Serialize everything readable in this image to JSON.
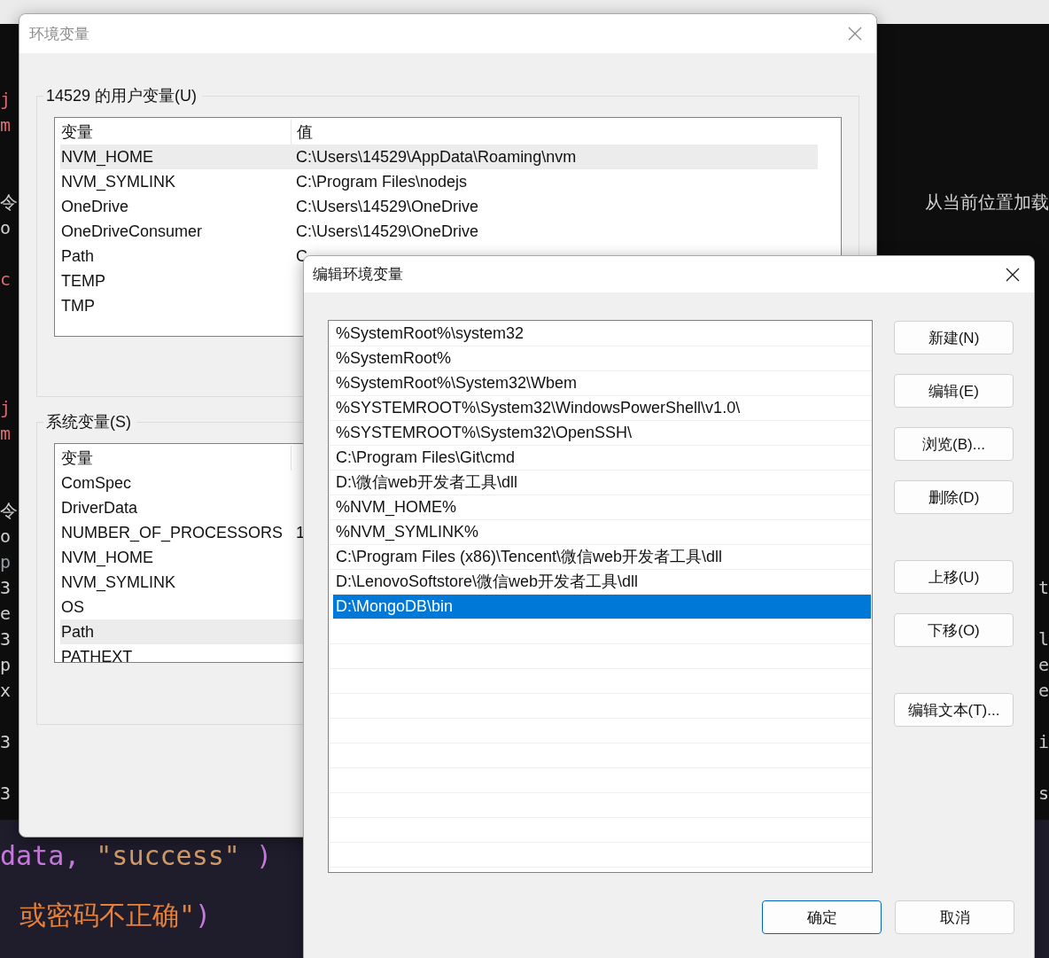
{
  "editor": {
    "lines": [
      {
        "kind": "code",
        "left": {
          "text": "j",
          "color": "#e06c75"
        }
      },
      {
        "kind": "code",
        "left": {
          "text": "m",
          "color": "#e06c75"
        }
      },
      {
        "kind": "blank"
      },
      {
        "kind": "blank"
      },
      {
        "kind": "code",
        "left": {
          "text": "令",
          "color": "#d4d4d4"
        },
        "right": {
          "text": "从当前位置加载",
          "color": "#d4d4d4"
        }
      },
      {
        "kind": "code",
        "left": {
          "text": "o",
          "color": "#d4d4d4"
        }
      },
      {
        "kind": "blank"
      },
      {
        "kind": "code",
        "left": {
          "text": "c",
          "color": "#e06c75"
        }
      },
      {
        "kind": "blank"
      },
      {
        "kind": "blank"
      },
      {
        "kind": "blank"
      },
      {
        "kind": "blank"
      },
      {
        "kind": "code",
        "left": {
          "text": "j",
          "color": "#e06c75"
        }
      },
      {
        "kind": "code",
        "left": {
          "text": "m",
          "color": "#e06c75"
        }
      },
      {
        "kind": "blank"
      },
      {
        "kind": "blank"
      },
      {
        "kind": "code",
        "left": {
          "text": "令",
          "color": "#d4d4d4"
        }
      },
      {
        "kind": "code",
        "left": {
          "text": "o",
          "color": "#d4d4d4"
        }
      },
      {
        "kind": "code",
        "left": {
          "text": "p",
          "color": "#9a9fa8"
        }
      },
      {
        "kind": "code",
        "left": {
          "text": "3",
          "color": "#d4d4d4"
        },
        "right": {
          "text": "t",
          "color": "#d4d4d4"
        }
      },
      {
        "kind": "code",
        "left": {
          "text": "e",
          "color": "#d4d4d4"
        }
      },
      {
        "kind": "code",
        "left": {
          "text": "3",
          "color": "#d4d4d4"
        },
        "right": {
          "text": "l",
          "color": "#d4d4d4"
        }
      },
      {
        "kind": "code",
        "left": {
          "text": "p",
          "color": "#d4d4d4"
        },
        "right": {
          "text": "e",
          "color": "#d4d4d4"
        }
      },
      {
        "kind": "code",
        "left": {
          "text": "x",
          "color": "#d4d4d4"
        },
        "right": {
          "text": "e",
          "color": "#d4d4d4"
        }
      },
      {
        "kind": "blank"
      },
      {
        "kind": "code",
        "left": {
          "text": "3",
          "color": "#d4d4d4"
        },
        "right": {
          "text": "i",
          "color": "#d4d4d4"
        }
      },
      {
        "kind": "blank"
      },
      {
        "kind": "code",
        "left": {
          "text": "3",
          "color": "#d4d4d4"
        },
        "right": {
          "text": "s",
          "color": "#d4d4d4"
        }
      }
    ],
    "bottom_lines": [
      [
        {
          "text": "data,",
          "color": "#c678dd"
        },
        {
          "text": "\"success\"",
          "color": "#d19a66"
        },
        {
          "text": ")",
          "color": "#c678dd"
        }
      ],
      [
        {
          "text": "或密码不正确\"",
          "color": "#e5813b"
        },
        {
          "text": ")",
          "color": "#c678dd"
        }
      ]
    ]
  },
  "env_window": {
    "title": "环境变量",
    "user_group": {
      "title": "14529 的用户变量(U)",
      "columns": [
        "变量",
        "值"
      ],
      "rows": [
        {
          "name": "NVM_HOME",
          "value": "C:\\Users\\14529\\AppData\\Roaming\\nvm",
          "selected": true
        },
        {
          "name": "NVM_SYMLINK",
          "value": "C:\\Program Files\\nodejs",
          "selected": false
        },
        {
          "name": "OneDrive",
          "value": "C:\\Users\\14529\\OneDrive",
          "selected": false
        },
        {
          "name": "OneDriveConsumer",
          "value": "C:\\Users\\14529\\OneDrive",
          "selected": false
        },
        {
          "name": "Path",
          "value": "C",
          "selected": false
        },
        {
          "name": "TEMP",
          "selected": false
        },
        {
          "name": "TMP",
          "selected": false
        }
      ]
    },
    "system_group": {
      "title": "系统变量(S)",
      "columns": [
        "变量"
      ],
      "rows": [
        {
          "name": "ComSpec",
          "selected": false
        },
        {
          "name": "DriverData",
          "selected": false
        },
        {
          "name": "NUMBER_OF_PROCESSORS",
          "value": "1",
          "selected": false
        },
        {
          "name": "NVM_HOME",
          "selected": false
        },
        {
          "name": "NVM_SYMLINK",
          "selected": false
        },
        {
          "name": "OS",
          "selected": false
        },
        {
          "name": "Path",
          "selected": true
        },
        {
          "name": "PATHEXT",
          "selected": false
        }
      ]
    }
  },
  "edit_dialog": {
    "title": "编辑环境变量",
    "entries": [
      {
        "text": "%SystemRoot%\\system32",
        "selected": false
      },
      {
        "text": "%SystemRoot%",
        "selected": false
      },
      {
        "text": "%SystemRoot%\\System32\\Wbem",
        "selected": false
      },
      {
        "text": "%SYSTEMROOT%\\System32\\WindowsPowerShell\\v1.0\\",
        "selected": false
      },
      {
        "text": "%SYSTEMROOT%\\System32\\OpenSSH\\",
        "selected": false
      },
      {
        "text": "C:\\Program Files\\Git\\cmd",
        "selected": false
      },
      {
        "text": "D:\\微信web开发者工具\\dll",
        "selected": false
      },
      {
        "text": "%NVM_HOME%",
        "selected": false
      },
      {
        "text": "%NVM_SYMLINK%",
        "selected": false
      },
      {
        "text": "C:\\Program Files (x86)\\Tencent\\微信web开发者工具\\dll",
        "selected": false
      },
      {
        "text": "D:\\LenovoSoftstore\\微信web开发者工具\\dll",
        "selected": false
      },
      {
        "text": "D:\\MongoDB\\bin",
        "selected": true
      }
    ],
    "button_groups": [
      [
        "新建(N)",
        "编辑(E)",
        "浏览(B)...",
        "删除(D)"
      ],
      [
        "上移(U)",
        "下移(O)"
      ],
      [
        "编辑文本(T)..."
      ]
    ],
    "footer_buttons": [
      {
        "label": "确定",
        "default": true
      },
      {
        "label": "取消",
        "default": false
      }
    ]
  }
}
